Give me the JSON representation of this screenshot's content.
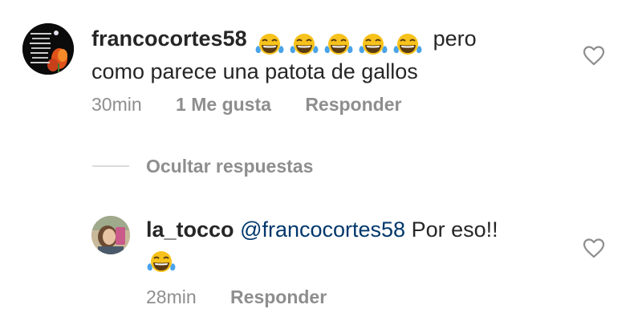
{
  "comment": {
    "username": "francocortes58",
    "text_line1_suffix": "pero",
    "text_line2": "como parece una patota de gallos",
    "emojis": [
      "face-with-tears-of-joy",
      "face-with-tears-of-joy",
      "face-with-tears-of-joy",
      "face-with-tears-of-joy",
      "face-with-tears-of-joy"
    ],
    "time": "30min",
    "likes": "1 Me gusta",
    "reply_label": "Responder"
  },
  "replies_toggle": {
    "label": "Ocultar respuestas"
  },
  "reply": {
    "username": "la_tocco",
    "mention": "@francocortes58",
    "text": "Por eso!!",
    "emojis": [
      "face-with-tears-of-joy"
    ],
    "time": "28min",
    "reply_label": "Responder"
  },
  "colors": {
    "text": "#262626",
    "secondary": "#8e8e8e",
    "mention": "#00376b",
    "divider": "#dbdbdb"
  }
}
